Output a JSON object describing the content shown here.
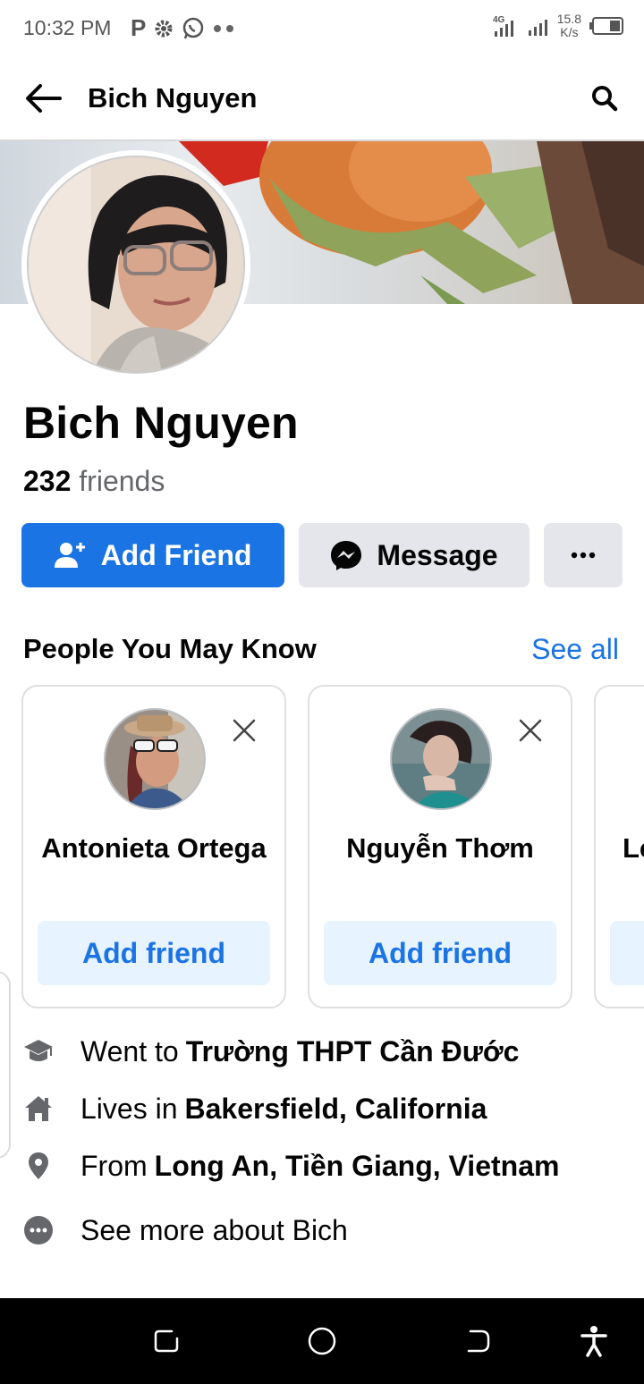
{
  "status_bar": {
    "time": "10:32 PM",
    "left_icons": [
      "parking-icon",
      "settings-icon",
      "whatsapp-icon",
      "more-dots-icon"
    ],
    "network": "4G",
    "speed_value": "15.8",
    "speed_unit": "K/s"
  },
  "app_bar": {
    "title": "Bich Nguyen",
    "back_icon": "arrow-left-icon",
    "search_icon": "search-icon"
  },
  "profile": {
    "name": "Bich Nguyen",
    "friends_count": "232",
    "friends_label": "friends"
  },
  "actions": {
    "add_friend": "Add Friend",
    "message": "Message",
    "more": "more-options-icon"
  },
  "people_you_may_know": {
    "title": "People You May Know",
    "see_all": "See all",
    "cards": [
      {
        "name": "Antonieta Ortega",
        "button": "Add friend"
      },
      {
        "name": "Nguyễn Thơm",
        "button": "Add friend"
      },
      {
        "name": "Le",
        "button": ""
      }
    ]
  },
  "details": [
    {
      "icon": "graduation-cap-icon",
      "prefix": "Went to",
      "value": "Trường THPT Cần Đước"
    },
    {
      "icon": "home-icon",
      "prefix": "Lives in",
      "value": "Bakersfield, California"
    },
    {
      "icon": "location-pin-icon",
      "prefix": "From",
      "value": "Long An, Tiền Giang, Vietnam"
    },
    {
      "icon": "more-circle-icon",
      "prefix": "See more about Bich",
      "value": ""
    }
  ],
  "colors": {
    "primary": "#1b74e4",
    "secondary_button": "#e4e6eb",
    "light_blue_button": "#e7f3ff",
    "muted_text": "#65676b"
  }
}
